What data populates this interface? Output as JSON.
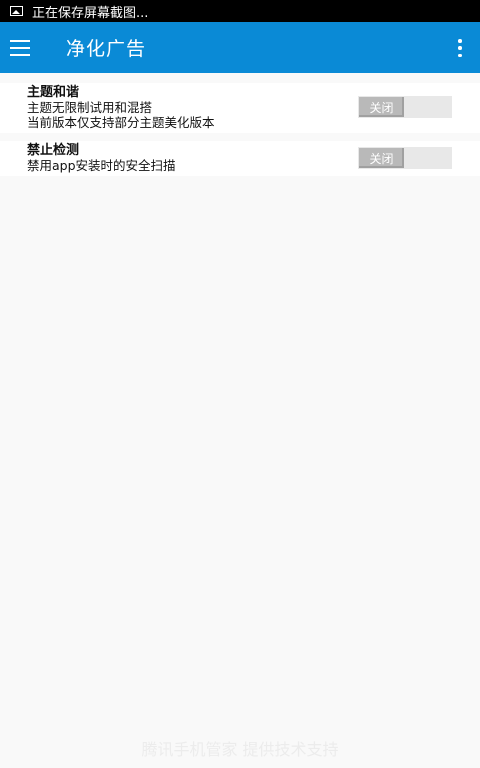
{
  "status_bar": {
    "text": "正在保存屏幕截图..."
  },
  "app_bar": {
    "title": "净化广告"
  },
  "settings": [
    {
      "title": "主题和谐",
      "desc_lines": [
        "主题无限制试用和混搭",
        "当前版本仅支持部分主题美化版本"
      ],
      "toggle_label": "关闭",
      "enabled": false
    },
    {
      "title": "禁止检测",
      "desc_lines": [
        "禁用app安装时的安全扫描"
      ],
      "toggle_label": "关闭",
      "enabled": false
    }
  ],
  "watermark": {
    "text": "腾讯手机管家 提供技术支持"
  }
}
